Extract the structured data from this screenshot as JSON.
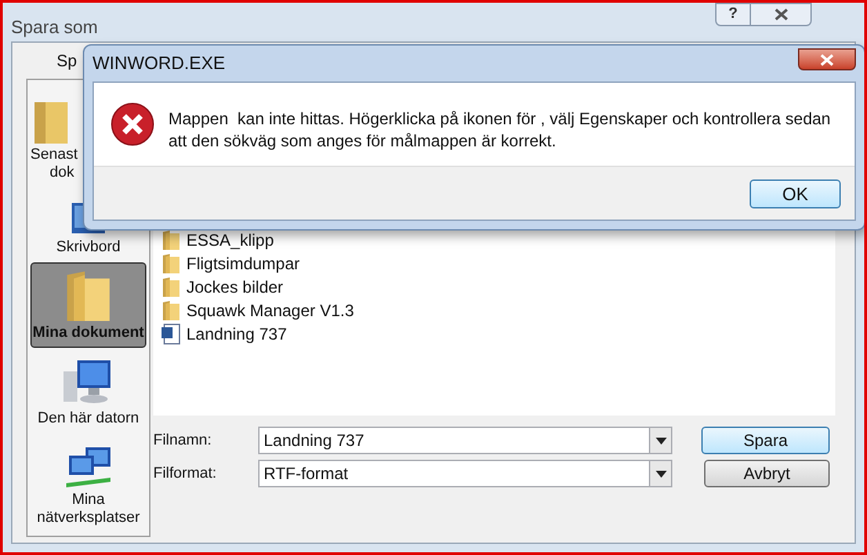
{
  "window": {
    "title": "Spara som",
    "help_button": "?"
  },
  "location_label": "Sp",
  "sidebar": {
    "items": [
      {
        "kind": "recent",
        "label": "Senast",
        "label_line2": "dok",
        "selected": false
      },
      {
        "kind": "desktop",
        "label": "Skrivbord",
        "selected": false
      },
      {
        "kind": "documents",
        "label": "Mina dokument",
        "selected": true
      },
      {
        "kind": "computer",
        "label": "Den här datorn",
        "selected": false
      },
      {
        "kind": "network",
        "label": "Mina",
        "label_line2": "nätverksplatser",
        "selected": false
      }
    ]
  },
  "files": [
    {
      "kind": "folder",
      "name": "ESSA_klipp"
    },
    {
      "kind": "folder",
      "name": "Fligtsimdumpar"
    },
    {
      "kind": "folder",
      "name": "Jockes bilder"
    },
    {
      "kind": "folder",
      "name": "Squawk Manager V1.3"
    },
    {
      "kind": "document",
      "name": "Landning 737"
    }
  ],
  "form": {
    "filename_label": "Filnamn:",
    "filename": "Landning 737",
    "format_label": "Filformat:",
    "format": "RTF-format"
  },
  "buttons": [
    "Spara",
    "Avbryt"
  ],
  "error_dialog": {
    "title": "WINWORD.EXE",
    "message": "Mappen  kan inte hittas. Högerklicka på ikonen för , välj Egenskaper och kontrollera sedan att den sökväg som anges för målmappen är korrekt.",
    "button": "OK"
  }
}
